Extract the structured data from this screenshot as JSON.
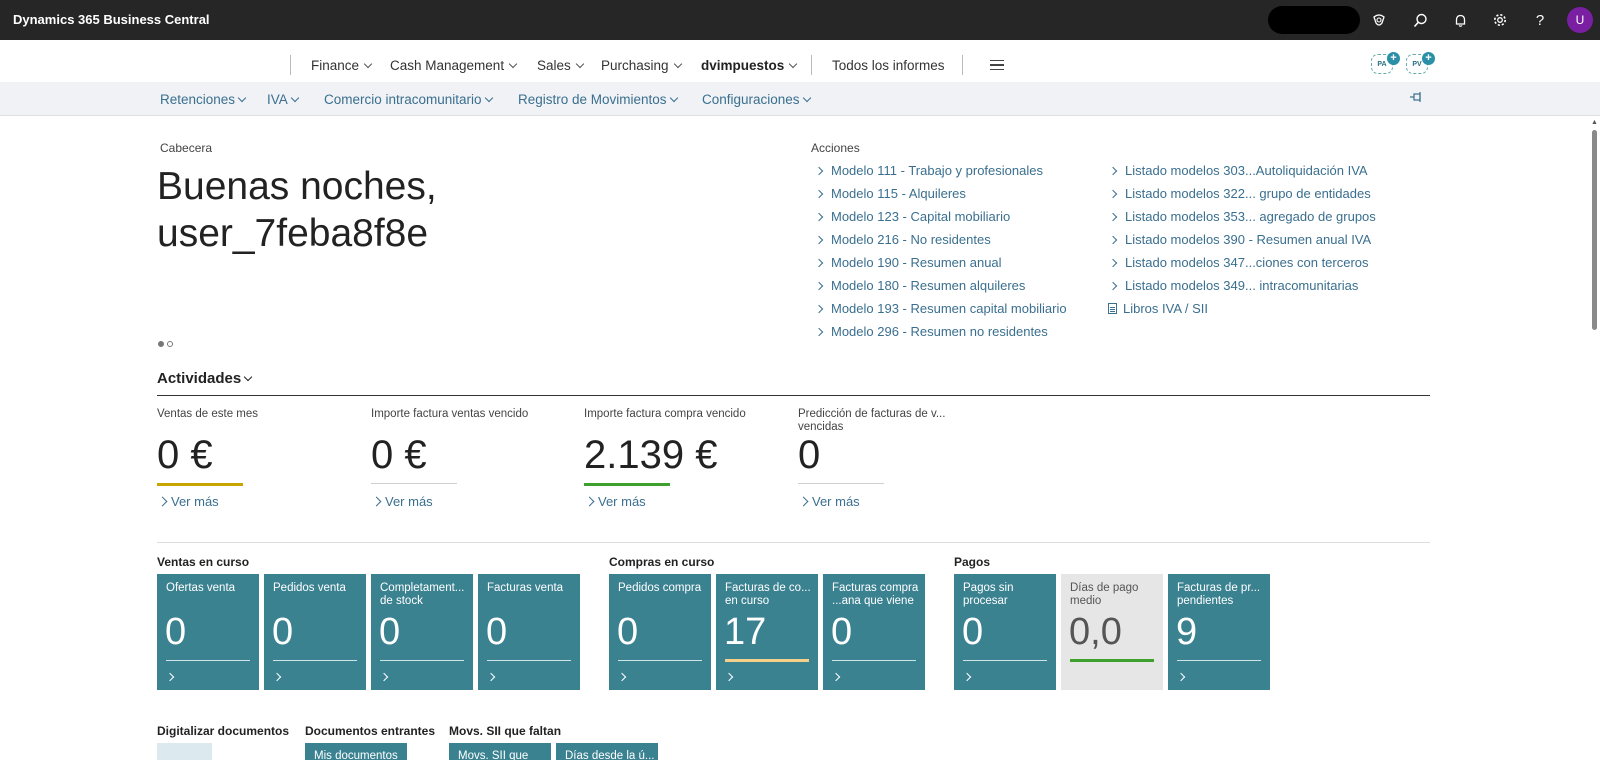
{
  "topbar": {
    "app_title": "Dynamics 365 Business Central",
    "icons": [
      "copilot-icon",
      "search-icon",
      "bell-icon",
      "gear-icon",
      "help-icon"
    ],
    "help_glyph": "?",
    "avatar_initial": "U",
    "avatar_color": "#7a1fa2"
  },
  "nav": {
    "items": [
      "Finance",
      "Cash Management",
      "Sales",
      "Purchasing",
      "dvimpuestos"
    ],
    "reports": "Todos los informes",
    "pa_badge": "PA",
    "pv_badge": "PV",
    "plus": "+"
  },
  "subnav": {
    "items": [
      "Retenciones",
      "IVA",
      "Comercio intracomunitario",
      "Registro de Movimientos",
      "Configuraciones"
    ]
  },
  "headline": {
    "label": "Cabecera",
    "greeting_line1": "Buenas noches,",
    "greeting_line2": "user_7feba8f8e"
  },
  "actions": {
    "label": "Acciones",
    "col1": [
      "Modelo 111 - Trabajo y profesionales",
      "Modelo 115 - Alquileres",
      "Modelo 123 - Capital mobiliario",
      "Modelo 216 - No residentes",
      "Modelo 190 - Resumen anual",
      "Modelo 180 - Resumen alquileres",
      "Modelo 193 - Resumen capital mobiliario",
      "Modelo 296 - Resumen no residentes"
    ],
    "col2": [
      "Listado modelos 303...Autoliquidación IVA",
      "Listado modelos 322... grupo de entidades",
      "Listado modelos 353... agregado de grupos",
      "Listado modelos 390 - Resumen anual IVA",
      "Listado modelos 347...ciones con terceros",
      "Listado modelos 349... intracomunitarias",
      "Libros IVA / SII"
    ]
  },
  "activities": {
    "title": "Actividades",
    "kpis": [
      {
        "label": "Ventas de este mes",
        "value": "0 €",
        "more": "Ver más",
        "bar_color": "#c8a400"
      },
      {
        "label": "Importe factura ventas vencido",
        "value": "0 €",
        "more": "Ver más",
        "bar_color": "#d0d0d0"
      },
      {
        "label": "Importe factura compra vencido",
        "value": "2.139 €",
        "more": "Ver más",
        "bar_color": "#3ea12d"
      },
      {
        "label": "Predicción de facturas de v... vencidas",
        "value": "0",
        "more": "Ver más",
        "bar_color": "#d0d0d0"
      }
    ]
  },
  "groups": {
    "ventas": {
      "title": "Ventas en curso",
      "tiles": [
        {
          "label": "Ofertas venta",
          "value": "0"
        },
        {
          "label": "Pedidos venta",
          "value": "0"
        },
        {
          "label": "Completament... de stock",
          "value": "0"
        },
        {
          "label": "Facturas venta",
          "value": "0"
        }
      ]
    },
    "compras": {
      "title": "Compras en curso",
      "tiles": [
        {
          "label": "Pedidos compra",
          "value": "0"
        },
        {
          "label": "Facturas de co... en curso",
          "value": "17"
        },
        {
          "label": "Facturas compra ...ana que viene",
          "value": "0"
        }
      ]
    },
    "pagos": {
      "title": "Pagos",
      "tiles": [
        {
          "label": "Pagos sin procesar",
          "value": "0"
        },
        {
          "label": "Días de pago medio",
          "value": "0,0"
        },
        {
          "label": "Facturas de pr... pendientes",
          "value": "9"
        }
      ]
    }
  },
  "bottom": {
    "digitalizar": "Digitalizar documentos",
    "entrantes": "Documentos entrantes",
    "entrantes_tile": "Mis documentos",
    "sii": "Movs. SII que faltan",
    "sii_tile1": "Movs. SII que",
    "sii_tile2": "Días desde la ú..."
  },
  "colors": {
    "tile": "#3b8291",
    "link": "#3a6f8f",
    "topbar": "#262626"
  }
}
